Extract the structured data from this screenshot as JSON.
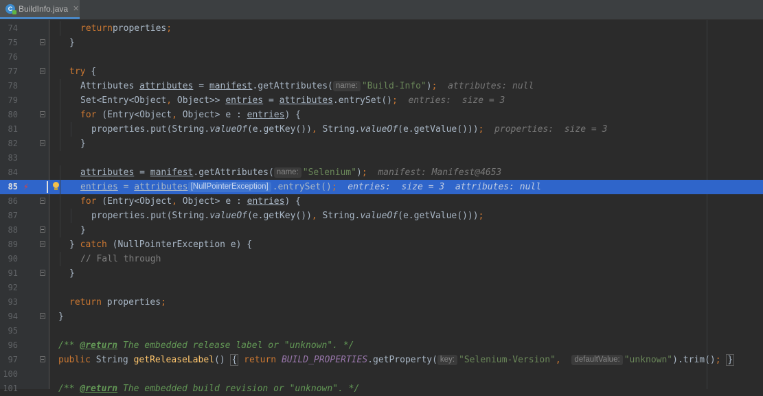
{
  "tab": {
    "title": "BuildInfo.java",
    "close": "✕",
    "icon_letter": "C"
  },
  "lines": [
    {
      "n": "74",
      "tokens": [
        [
          "kw",
          "return"
        ],
        [
          "",
          "properties"
        ],
        [
          "kw",
          ";"
        ]
      ]
    },
    {
      "n": "75",
      "tokens": [
        [
          "",
          "}"
        ]
      ]
    },
    {
      "n": "76",
      "tokens": []
    },
    {
      "n": "77",
      "tokens": [
        [
          "kw",
          "try"
        ],
        [
          "",
          " {"
        ]
      ]
    },
    {
      "n": "78",
      "tokens": [
        [
          "",
          "Attributes "
        ],
        [
          "ul",
          "attributes"
        ],
        [
          "",
          " = "
        ],
        [
          "ul",
          "manifest"
        ],
        [
          "",
          ".getAttributes("
        ],
        [
          "hint",
          "name:"
        ],
        [
          "str",
          "\"Build-Info\""
        ],
        [
          "",
          ")"
        ],
        [
          "kw",
          ";"
        ],
        [
          "inl",
          "  attributes: null"
        ]
      ]
    },
    {
      "n": "79",
      "tokens": [
        [
          "",
          "Set<Entry<Object"
        ],
        [
          "kw",
          ","
        ],
        [
          "",
          " Object>> "
        ],
        [
          "ul",
          "entries"
        ],
        [
          "",
          " = "
        ],
        [
          "ul",
          "attributes"
        ],
        [
          "",
          ".entrySet()"
        ],
        [
          "kw",
          ";"
        ],
        [
          "inl",
          "  entries:  size = 3"
        ]
      ]
    },
    {
      "n": "80",
      "tokens": [
        [
          "kw",
          "for"
        ],
        [
          "",
          " (Entry<Object"
        ],
        [
          "kw",
          ","
        ],
        [
          "",
          " Object> e : "
        ],
        [
          "ul",
          "entries"
        ],
        [
          "",
          ") {"
        ]
      ]
    },
    {
      "n": "81",
      "tokens": [
        [
          "",
          "properties.put(String."
        ],
        [
          "it",
          "valueOf"
        ],
        [
          "",
          "(e.getKey())"
        ],
        [
          "kw",
          ","
        ],
        [
          "",
          " String."
        ],
        [
          "it",
          "valueOf"
        ],
        [
          "",
          "(e.getValue()))"
        ],
        [
          "kw",
          ";"
        ],
        [
          "inl",
          "  properties:  size = 3"
        ]
      ]
    },
    {
      "n": "82",
      "tokens": [
        [
          "",
          "}"
        ]
      ]
    },
    {
      "n": "83",
      "tokens": []
    },
    {
      "n": "84",
      "tokens": [
        [
          "ul",
          "attributes"
        ],
        [
          "",
          " = "
        ],
        [
          "ul",
          "manifest"
        ],
        [
          "",
          ".getAttributes("
        ],
        [
          "hint",
          "name:"
        ],
        [
          "str",
          "\"Selenium\""
        ],
        [
          "",
          ")"
        ],
        [
          "kw",
          ";"
        ],
        [
          "inl",
          "  manifest: Manifest@4653"
        ]
      ]
    },
    {
      "n": "85",
      "tokens": [
        [
          "ul",
          "entries"
        ],
        [
          "",
          " = "
        ],
        [
          "ul",
          "attributes"
        ],
        [
          "hint",
          "[NullPointerException]"
        ],
        [
          "",
          ".entrySet()"
        ],
        [
          "kw",
          ";"
        ],
        [
          "inl",
          "  entries:  size = 3  attributes: null"
        ]
      ]
    },
    {
      "n": "86",
      "tokens": [
        [
          "kw",
          "for"
        ],
        [
          "",
          " (Entry<Object"
        ],
        [
          "kw",
          ","
        ],
        [
          "",
          " Object> e : "
        ],
        [
          "ul",
          "entries"
        ],
        [
          "",
          ") {"
        ]
      ]
    },
    {
      "n": "87",
      "tokens": [
        [
          "",
          "properties.put(String."
        ],
        [
          "it",
          "valueOf"
        ],
        [
          "",
          "(e.getKey())"
        ],
        [
          "kw",
          ","
        ],
        [
          "",
          " String."
        ],
        [
          "it",
          "valueOf"
        ],
        [
          "",
          "(e.getValue()))"
        ],
        [
          "kw",
          ";"
        ]
      ]
    },
    {
      "n": "88",
      "tokens": [
        [
          "",
          "}"
        ]
      ]
    },
    {
      "n": "89",
      "tokens": [
        [
          "",
          "} "
        ],
        [
          "kw",
          "catch"
        ],
        [
          "",
          " (NullPointerException e) {"
        ]
      ]
    },
    {
      "n": "90",
      "tokens": [
        [
          "cm",
          "// Fall through"
        ]
      ]
    },
    {
      "n": "91",
      "tokens": [
        [
          "",
          "}"
        ]
      ]
    },
    {
      "n": "92",
      "tokens": []
    },
    {
      "n": "93",
      "tokens": [
        [
          "kw",
          "return"
        ],
        [
          "",
          " properties"
        ],
        [
          "kw",
          ";"
        ]
      ]
    },
    {
      "n": "94",
      "tokens": [
        [
          "",
          "}"
        ]
      ]
    },
    {
      "n": "95",
      "tokens": []
    },
    {
      "n": "96",
      "tokens": [
        [
          "doc",
          "/** "
        ],
        [
          "doctag",
          "@return"
        ],
        [
          "doc",
          " The embedded release label or \"unknown\". */"
        ]
      ]
    },
    {
      "n": "97",
      "tokens": [
        [
          "kw",
          "public"
        ],
        [
          "",
          " String "
        ],
        [
          "fn",
          "getReleaseLabel"
        ],
        [
          "",
          "() "
        ],
        [
          "box",
          "{"
        ],
        [
          "",
          " "
        ],
        [
          "kw",
          "return"
        ],
        [
          "",
          " "
        ],
        [
          "stat",
          "BUILD_PROPERTIES"
        ],
        [
          "",
          ".getProperty("
        ],
        [
          "hint",
          "key:"
        ],
        [
          "str",
          "\"Selenium-Version\""
        ],
        [
          "kw",
          ","
        ],
        [
          "",
          "  "
        ],
        [
          "hint",
          "defaultValue:"
        ],
        [
          "str",
          "\"unknown\""
        ],
        [
          "",
          ").trim()"
        ],
        [
          "kw",
          ";"
        ],
        [
          "",
          " "
        ],
        [
          "box",
          "}"
        ]
      ]
    },
    {
      "n": "100",
      "tokens": []
    },
    {
      "n": "101",
      "tokens": [
        [
          "doc",
          "/** "
        ],
        [
          "doctag",
          "@return"
        ],
        [
          "doc",
          " The embedded build revision or \"unknown\". */"
        ]
      ]
    }
  ]
}
